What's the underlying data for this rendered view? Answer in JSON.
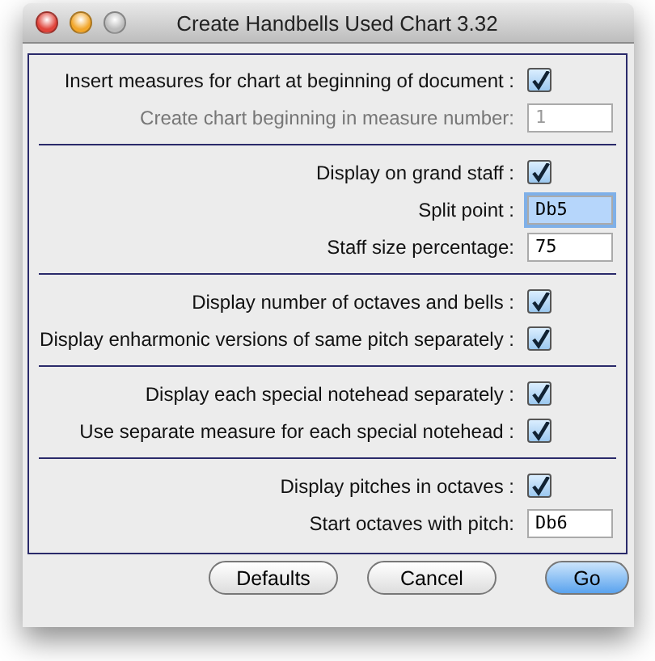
{
  "window": {
    "title": "Create Handbells Used Chart 3.32"
  },
  "sections": [
    {
      "rows": [
        {
          "kind": "checkbox",
          "label": "Insert measures for chart at beginning of document :",
          "checked": true
        },
        {
          "kind": "field",
          "label": "Create chart beginning in measure number:",
          "value": "1",
          "disabled": true,
          "focused": false
        }
      ]
    },
    {
      "rows": [
        {
          "kind": "checkbox",
          "label": "Display on grand staff :",
          "checked": true
        },
        {
          "kind": "field",
          "label": "Split point :",
          "value": "Db5",
          "disabled": false,
          "focused": true
        },
        {
          "kind": "field",
          "label": "Staff size percentage:",
          "value": "75",
          "disabled": false,
          "focused": false
        }
      ]
    },
    {
      "rows": [
        {
          "kind": "checkbox",
          "label": "Display number of octaves and bells :",
          "checked": true
        },
        {
          "kind": "checkbox",
          "label": "Display enharmonic versions of same pitch separately :",
          "checked": true
        }
      ]
    },
    {
      "rows": [
        {
          "kind": "checkbox",
          "label": "Display each special notehead separately :",
          "checked": true
        },
        {
          "kind": "checkbox",
          "label": "Use separate measure for each special notehead :",
          "checked": true
        }
      ]
    },
    {
      "rows": [
        {
          "kind": "checkbox",
          "label": "Display pitches in octaves :",
          "checked": true
        },
        {
          "kind": "field",
          "label": "Start octaves with pitch:",
          "value": "Db6",
          "disabled": false,
          "focused": false
        }
      ]
    }
  ],
  "buttons": [
    {
      "label": "Defaults",
      "default": false
    },
    {
      "label": "Cancel",
      "default": false
    },
    {
      "label": "Go",
      "default": true
    }
  ]
}
